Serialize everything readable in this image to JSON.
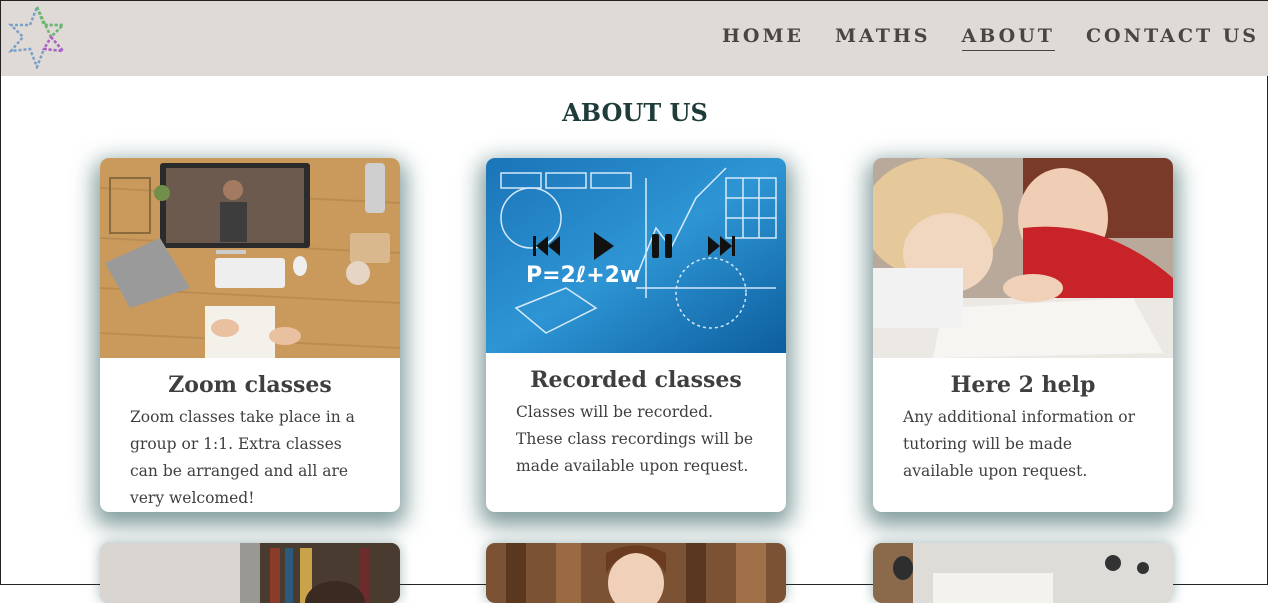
{
  "nav": {
    "items": [
      {
        "label": "HOME",
        "active": false
      },
      {
        "label": "MATHS",
        "active": false
      },
      {
        "label": "ABOUT",
        "active": true
      },
      {
        "label": "CONTACT US",
        "active": false
      }
    ]
  },
  "page": {
    "title": "ABOUT US"
  },
  "cards": [
    {
      "title": "Zoom classes",
      "text": "Zoom classes take place in a group or 1:1. Extra classes can be arranged and all are very welcomed!",
      "image": "desk-laptop-video-call"
    },
    {
      "title": "Recorded classes",
      "text": "Classes will be recorded. These class recordings will be made available upon request.",
      "image": "math-formulas-media-controls",
      "formula": "P=2ℓ+2w"
    },
    {
      "title": "Here 2 help",
      "text": "Any additional information or tutoring will be made available upon request.",
      "image": "two-people-studying"
    }
  ],
  "colors": {
    "navbar": "#dfdad6",
    "title": "#1d3c3a",
    "shadow": "#1f4e4e",
    "text": "#3f3f3f"
  }
}
